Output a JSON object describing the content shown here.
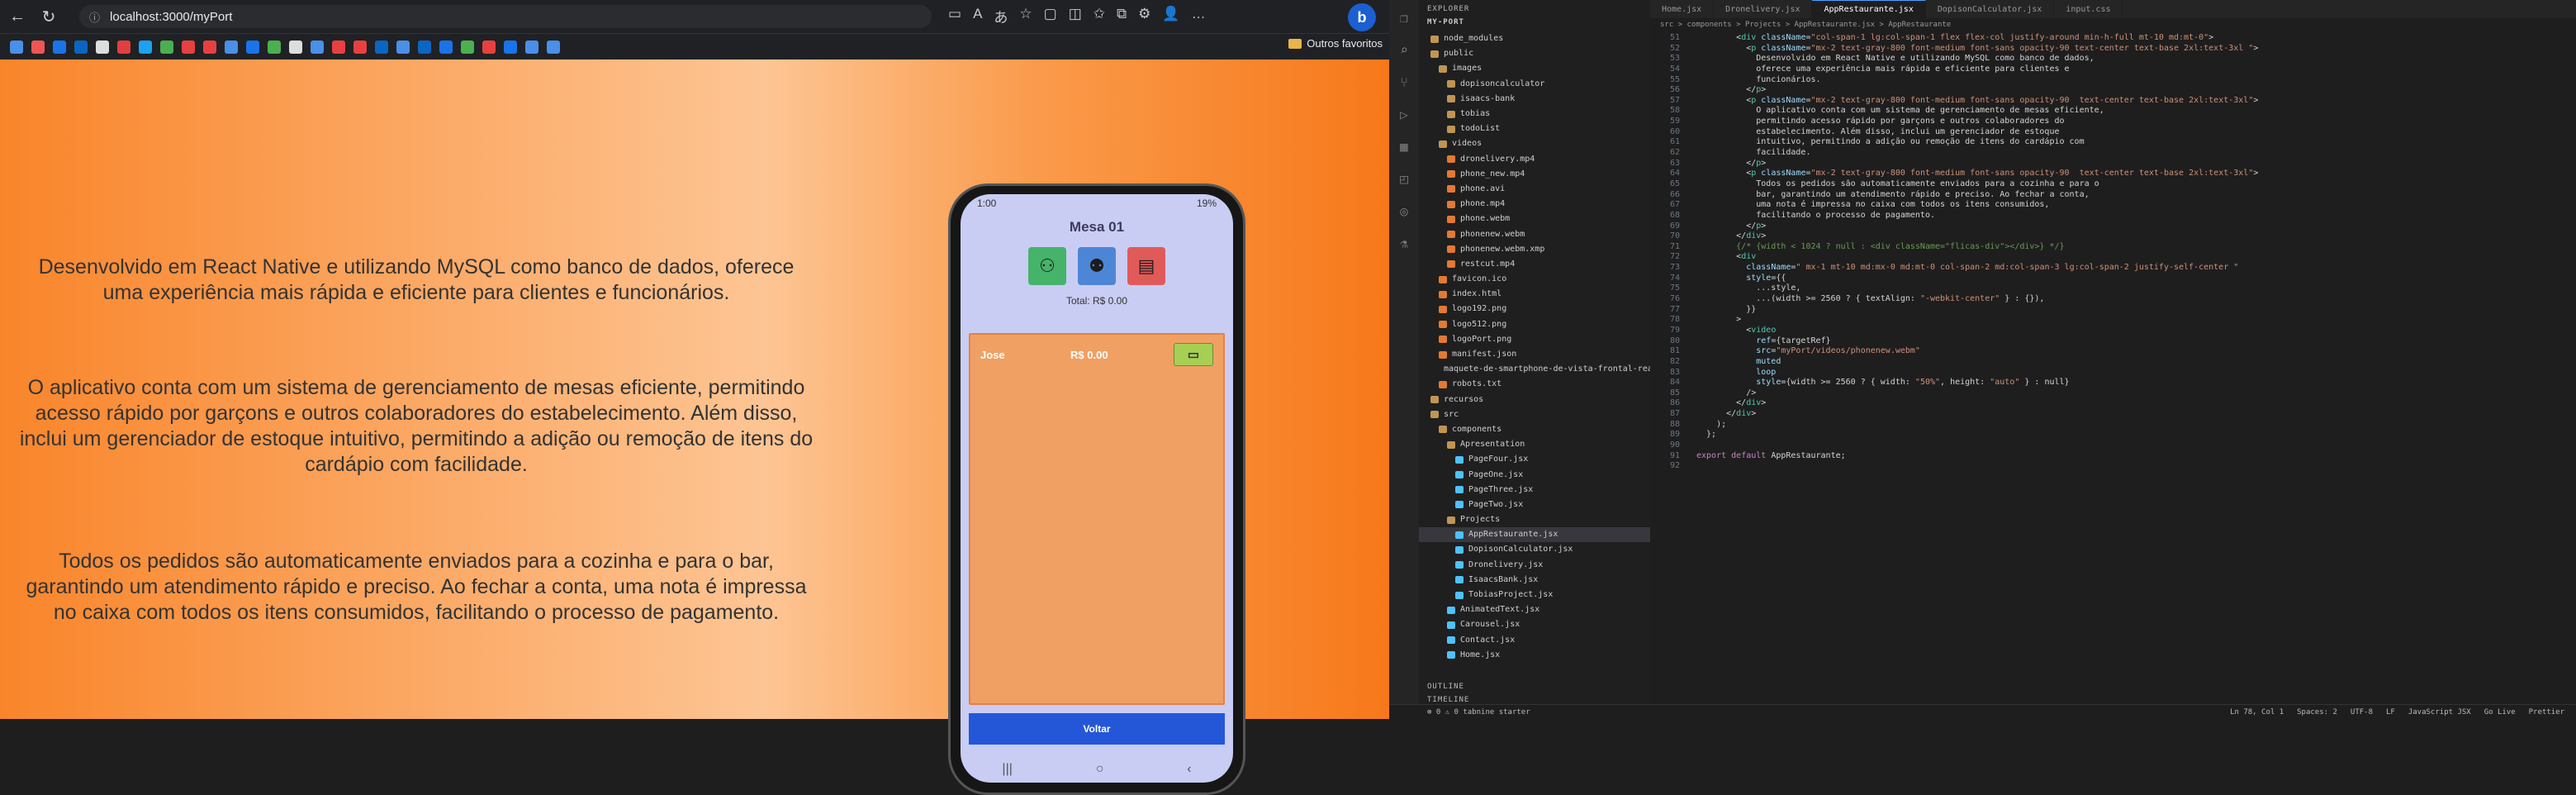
{
  "browser": {
    "url": "localhost:3000/myPort",
    "favorites_label": "Outros favoritos",
    "profile_initial": "b",
    "bookmark_colors": [
      "#4a8fe8",
      "#e55",
      "#1a73e8",
      "#0a66c2",
      "#ddd",
      "#e04040",
      "#1da1f2",
      "#4caf50",
      "#e84040",
      "#e84040",
      "#4a8fe8",
      "#1a73e8",
      "#4caf50",
      "#ddd",
      "#4a8fe8",
      "#e84040",
      "#e84040",
      "#0a66c2",
      "#4a8fe8",
      "#0a66c2",
      "#1a73e8",
      "#4caf50",
      "#e84040",
      "#1a73e8",
      "#4a8fe8",
      "#4a8fe8"
    ]
  },
  "page": {
    "paragraphs": [
      "Desenvolvido em React Native e utilizando MySQL como banco de dados, oferece uma experiência mais rápida e eficiente para clientes e funcionários.",
      "O aplicativo conta com um sistema de gerenciamento de mesas eficiente, permitindo acesso rápido por garçons e outros colaboradores do estabelecimento. Além disso, inclui um gerenciador de estoque intuitivo, permitindo a adição ou remoção de itens do cardápio com facilidade.",
      "Todos os pedidos são automaticamente enviados para a cozinha e para o bar, garantindo um atendimento rápido e preciso. Ao fechar a conta, uma nota é impressa no caixa com todos os itens consumidos, facilitando o processo de pagamento."
    ]
  },
  "phone": {
    "time": "1:00",
    "battery": "19%",
    "title": "Mesa 01",
    "total": "Total: R$ 0.00",
    "order_name": "Jose",
    "order_value": "R$ 0.00",
    "back_button": "Voltar",
    "action_colors": [
      "#46b36a",
      "#4d86d6",
      "#e05a5a"
    ]
  },
  "vscode": {
    "explorer_title": "EXPLORER",
    "project": "MY-PORT",
    "tree": [
      {
        "label": "node_modules",
        "type": "folder"
      },
      {
        "label": "public",
        "type": "folder"
      },
      {
        "label": "images",
        "type": "folder"
      },
      {
        "label": "dopisoncalculator",
        "type": "folder"
      },
      {
        "label": "isaacs-bank",
        "type": "folder"
      },
      {
        "label": "tobias",
        "type": "folder"
      },
      {
        "label": "todoList",
        "type": "folder"
      },
      {
        "label": "videos",
        "type": "folder"
      },
      {
        "label": "dronelivery.mp4",
        "type": "file"
      },
      {
        "label": "phone_new.mp4",
        "type": "file"
      },
      {
        "label": "phone.avi",
        "type": "file"
      },
      {
        "label": "phone.mp4",
        "type": "file"
      },
      {
        "label": "phone.webm",
        "type": "file"
      },
      {
        "label": "phonenew.webm",
        "type": "file"
      },
      {
        "label": "phonenew.webm.xmp",
        "type": "file"
      },
      {
        "label": "restcut.mp4",
        "type": "file"
      },
      {
        "label": "favicon.ico",
        "type": "file"
      },
      {
        "label": "index.html",
        "type": "file"
      },
      {
        "label": "logo192.png",
        "type": "file"
      },
      {
        "label": "logo512.png",
        "type": "file"
      },
      {
        "label": "logoPort.png",
        "type": "file"
      },
      {
        "label": "manifest.json",
        "type": "file"
      },
      {
        "label": "maquete-de-smartphone-de-vista-frontal-real...",
        "type": "file"
      },
      {
        "label": "robots.txt",
        "type": "file"
      },
      {
        "label": "recursos",
        "type": "folder"
      },
      {
        "label": "src",
        "type": "folder"
      },
      {
        "label": "components",
        "type": "folder"
      },
      {
        "label": "Apresentation",
        "type": "folder"
      },
      {
        "label": "PageFour.jsx",
        "type": "file"
      },
      {
        "label": "PageOne.jsx",
        "type": "file"
      },
      {
        "label": "PageThree.jsx",
        "type": "file"
      },
      {
        "label": "PageTwo.jsx",
        "type": "file"
      },
      {
        "label": "Projects",
        "type": "folder"
      },
      {
        "label": "AppRestaurante.jsx",
        "type": "file"
      },
      {
        "label": "DopisonCalculator.jsx",
        "type": "file"
      },
      {
        "label": "Dronelivery.jsx",
        "type": "file"
      },
      {
        "label": "IsaacsBank.jsx",
        "type": "file"
      },
      {
        "label": "TobiasProject.jsx",
        "type": "file"
      },
      {
        "label": "AnimatedText.jsx",
        "type": "file"
      },
      {
        "label": "Carousel.jsx",
        "type": "file"
      },
      {
        "label": "Contact.jsx",
        "type": "file"
      },
      {
        "label": "Home.jsx",
        "type": "file"
      }
    ],
    "outline": "OUTLINE",
    "timeline": "TIMELINE",
    "tabs": [
      "Home.jsx",
      "Dronelivery.jsx",
      "AppRestaurante.jsx",
      "DopisonCalculator.jsx",
      "input.css"
    ],
    "breadcrumb": "src > components > Projects > AppRestaurante.jsx > AppRestaurante",
    "code": [
      {
        "n": "51",
        "t": "        <div className=\"col-span-1 lg:col-span-1 flex flex-col justify-around min-h-full mt-10 md:mt-0\">"
      },
      {
        "n": "52",
        "t": "          <p className=\"mx-2 text-gray-800 font-medium font-sans opacity-90 text-center text-base 2xl:text-3xl \">"
      },
      {
        "n": "53",
        "t": "            Desenvolvido em React Native e utilizando MySQL como banco de dados,"
      },
      {
        "n": "54",
        "t": "            oferece uma experiência mais rápida e eficiente para clientes e"
      },
      {
        "n": "55",
        "t": "            funcionários."
      },
      {
        "n": "56",
        "t": "          </p>"
      },
      {
        "n": "57",
        "t": "          <p className=\"mx-2 text-gray-800 font-medium font-sans opacity-90  text-center text-base 2xl:text-3xl\">"
      },
      {
        "n": "58",
        "t": "            O aplicativo conta com um sistema de gerenciamento de mesas eficiente,"
      },
      {
        "n": "59",
        "t": "            permitindo acesso rápido por garçons e outros colaboradores do"
      },
      {
        "n": "60",
        "t": "            estabelecimento. Além disso, inclui um gerenciador de estoque"
      },
      {
        "n": "61",
        "t": "            intuitivo, permitindo a adição ou remoção de itens do cardápio com"
      },
      {
        "n": "62",
        "t": "            facilidade."
      },
      {
        "n": "63",
        "t": "          </p>"
      },
      {
        "n": "64",
        "t": "          <p className=\"mx-2 text-gray-800 font-medium font-sans opacity-90  text-center text-base 2xl:text-3xl\">"
      },
      {
        "n": "65",
        "t": "            Todos os pedidos são automaticamente enviados para a cozinha e para o"
      },
      {
        "n": "66",
        "t": "            bar, garantindo um atendimento rápido e preciso. Ao fechar a conta,"
      },
      {
        "n": "67",
        "t": "            uma nota é impressa no caixa com todos os itens consumidos,"
      },
      {
        "n": "68",
        "t": "            facilitando o processo de pagamento."
      },
      {
        "n": "69",
        "t": "          </p>"
      },
      {
        "n": "70",
        "t": "        </div>"
      },
      {
        "n": "71",
        "t": "        {/* {width < 1024 ? null : <div className=\"flicas-div\"></div>} */}"
      },
      {
        "n": "72",
        "t": "        <div"
      },
      {
        "n": "73",
        "t": "          className=\" mx-1 mt-10 md:mx-0 md:mt-0 col-span-2 md:col-span-3 lg:col-span-2 justify-self-center \""
      },
      {
        "n": "74",
        "t": "          style={{"
      },
      {
        "n": "75",
        "t": "            ...style,"
      },
      {
        "n": "76",
        "t": "            ...(width >= 2560 ? { textAlign: \"-webkit-center\" } : {}),"
      },
      {
        "n": "77",
        "t": "          }}"
      },
      {
        "n": "78",
        "t": "        >"
      },
      {
        "n": "79",
        "t": "          <video"
      },
      {
        "n": "80",
        "t": "            ref={targetRef}"
      },
      {
        "n": "81",
        "t": "            src=\"myPort/videos/phonenew.webm\""
      },
      {
        "n": "82",
        "t": "            muted"
      },
      {
        "n": "83",
        "t": "            loop"
      },
      {
        "n": "84",
        "t": "            style={width >= 2560 ? { width: \"50%\", height: \"auto\" } : null}"
      },
      {
        "n": "85",
        "t": "          />"
      },
      {
        "n": "86",
        "t": "        </div>"
      },
      {
        "n": "87",
        "t": "      </div>"
      },
      {
        "n": "88",
        "t": "    );"
      },
      {
        "n": "89",
        "t": "  };"
      },
      {
        "n": "90",
        "t": ""
      },
      {
        "n": "91",
        "t": "export default AppRestaurante;"
      },
      {
        "n": "92",
        "t": ""
      }
    ],
    "status_left": "⊗ 0 ⚠ 0   tabnine starter",
    "status_right": [
      "Ln 78, Col 1",
      "Spaces: 2",
      "UTF-8",
      "LF",
      "JavaScript JSX",
      "Go Live",
      "Prettier"
    ]
  }
}
